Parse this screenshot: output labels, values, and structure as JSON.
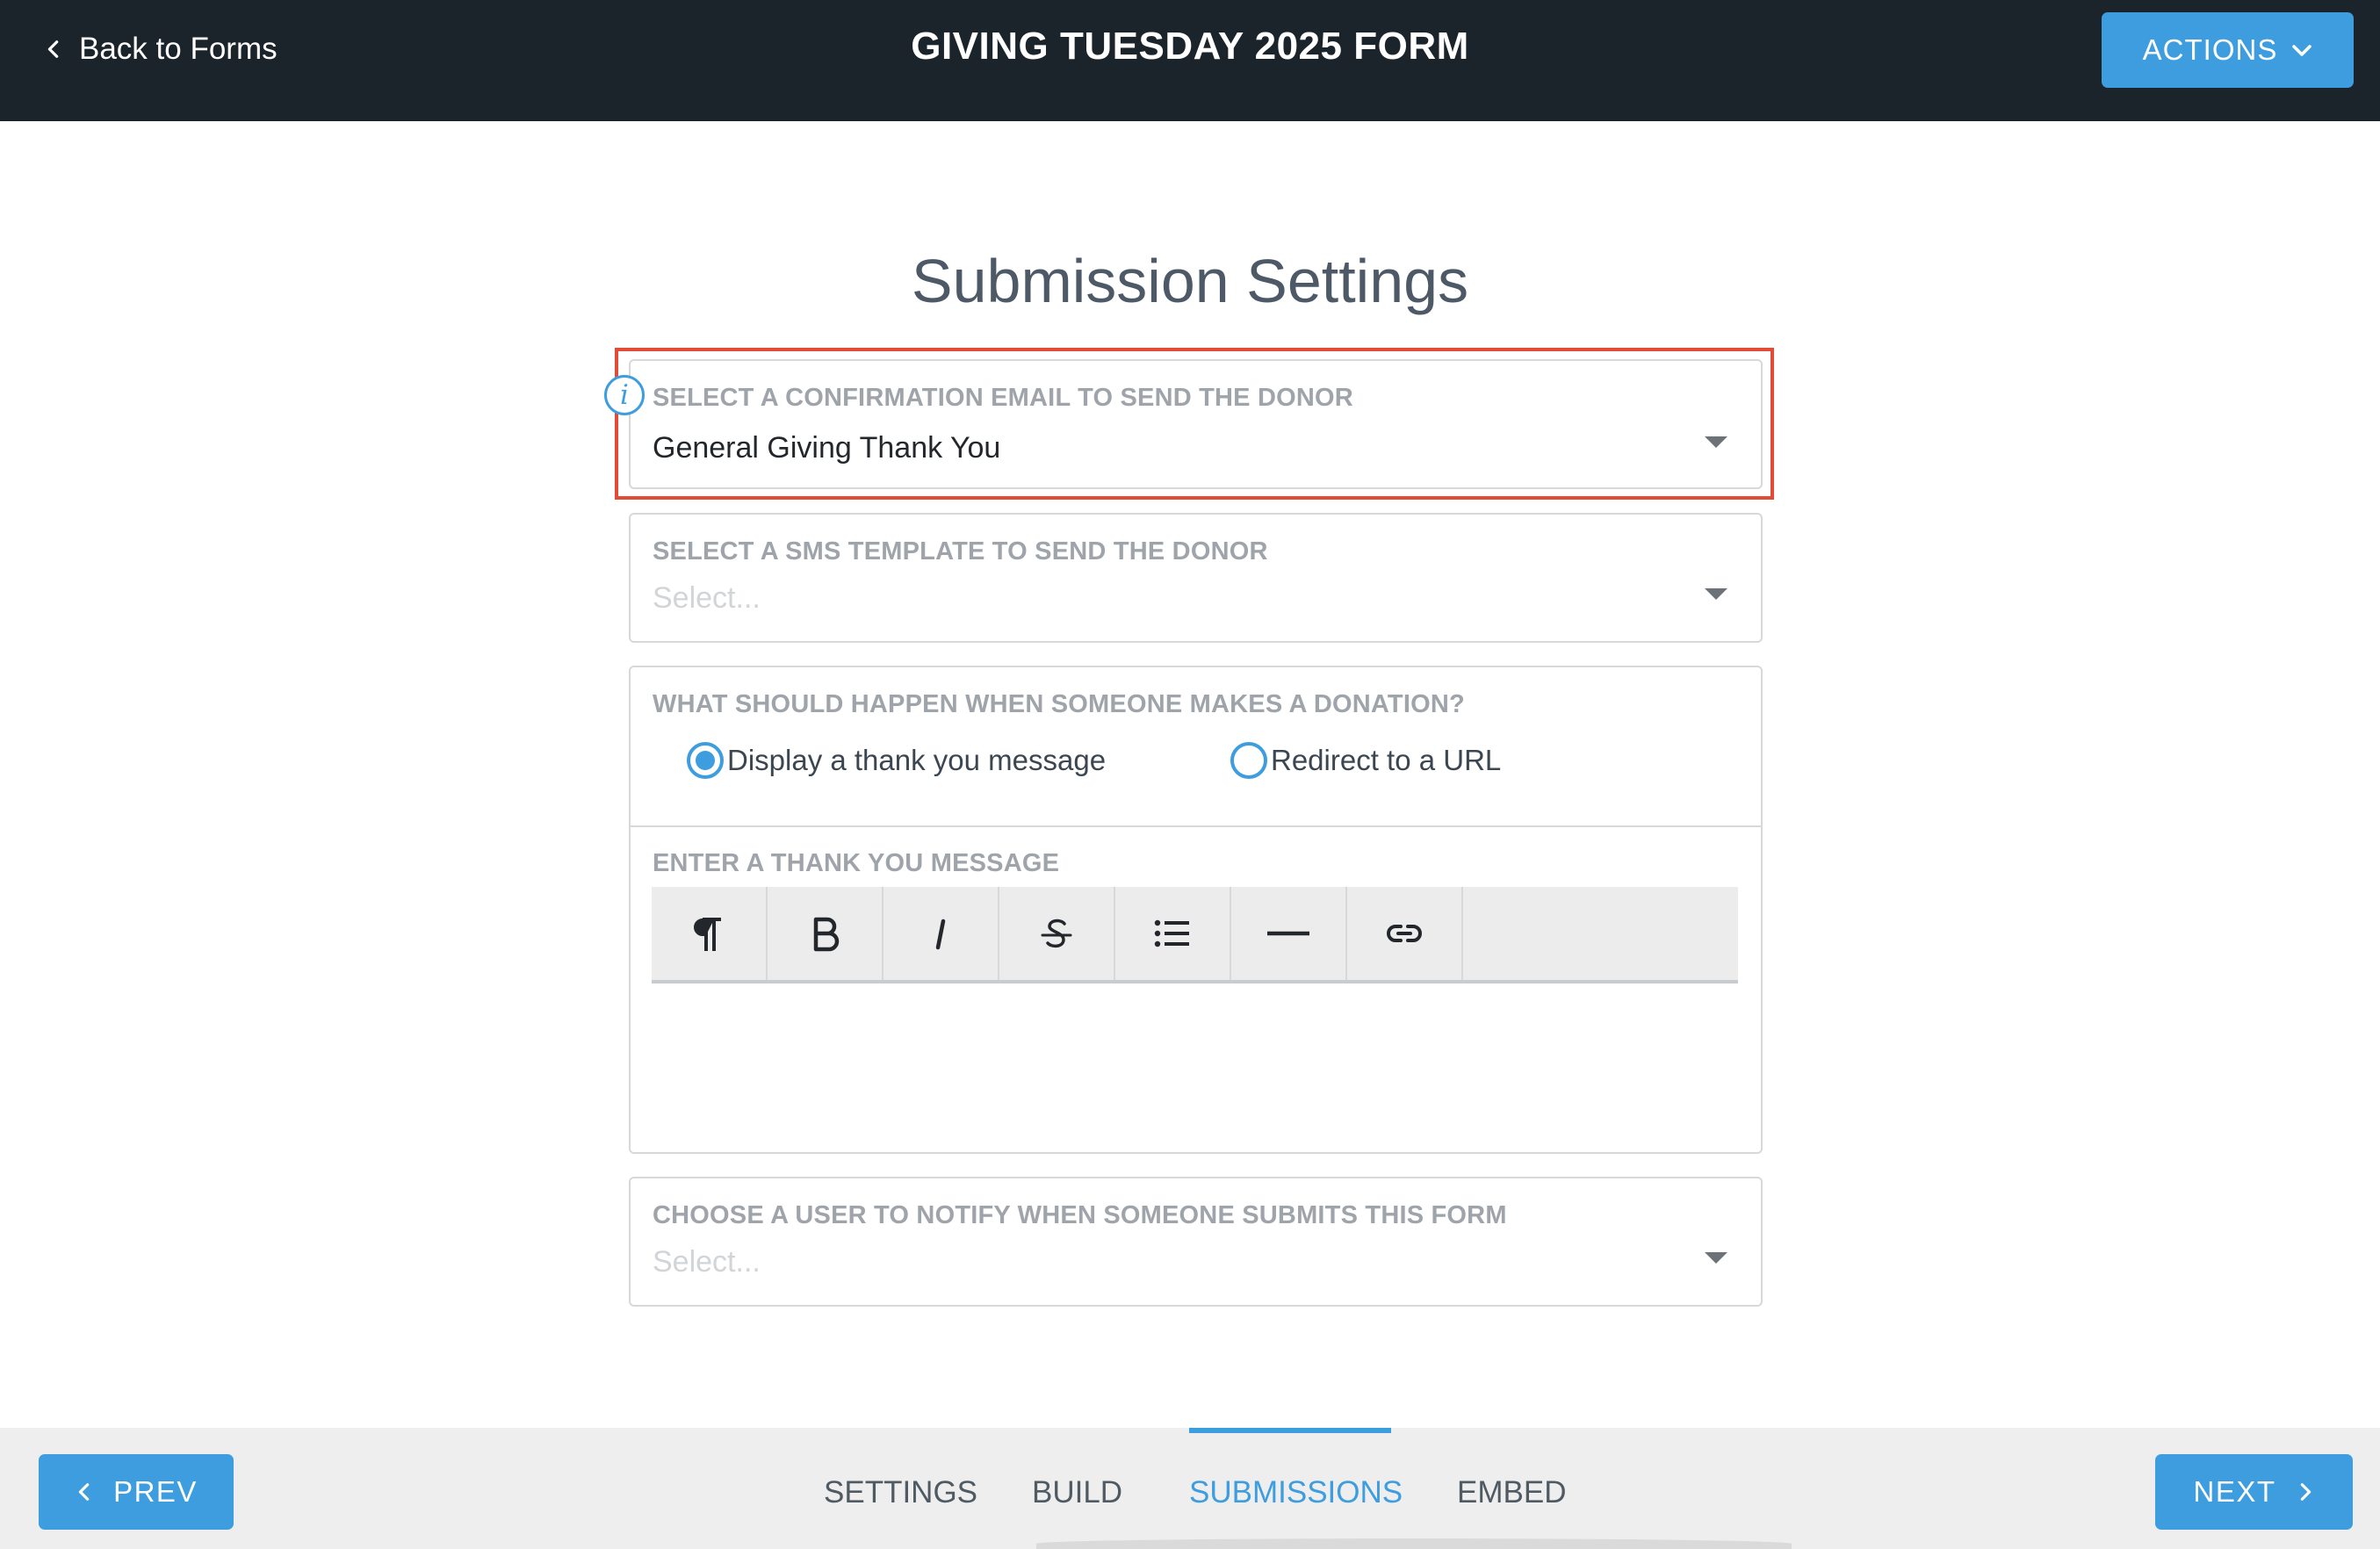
{
  "header": {
    "back_label": "Back to Forms",
    "title": "GIVING TUESDAY 2025 FORM",
    "actions_label": "ACTIONS"
  },
  "main": {
    "title": "Submission Settings",
    "confirmation_email": {
      "label": "SELECT A CONFIRMATION EMAIL TO SEND THE DONOR",
      "value": "General Giving Thank You"
    },
    "sms_template": {
      "label": "SELECT A SMS TEMPLATE TO SEND THE DONOR",
      "placeholder": "Select..."
    },
    "donation_action": {
      "label": "WHAT SHOULD HAPPEN WHEN SOMEONE MAKES A DONATION?",
      "options": [
        {
          "label": "Display a thank you message",
          "checked": true
        },
        {
          "label": "Redirect to a URL",
          "checked": false
        }
      ]
    },
    "thank_you_message": {
      "label": "ENTER A THANK YOU MESSAGE",
      "toolbar": [
        "paragraph-icon",
        "bold-icon",
        "italic-icon",
        "strikethrough-icon",
        "list-icon",
        "horizontal-rule-icon",
        "link-icon"
      ]
    },
    "notify_user": {
      "label": "CHOOSE A USER TO NOTIFY WHEN SOMEONE SUBMITS THIS FORM",
      "placeholder": "Select..."
    }
  },
  "footer": {
    "prev_label": "PREV",
    "next_label": "NEXT",
    "tabs": [
      "SETTINGS",
      "BUILD",
      "SUBMISSIONS",
      "EMBED"
    ],
    "active_tab": "SUBMISSIONS"
  },
  "colors": {
    "accent": "#3d9ddf",
    "header_bg": "#1b232b",
    "highlight": "#e24b35"
  }
}
